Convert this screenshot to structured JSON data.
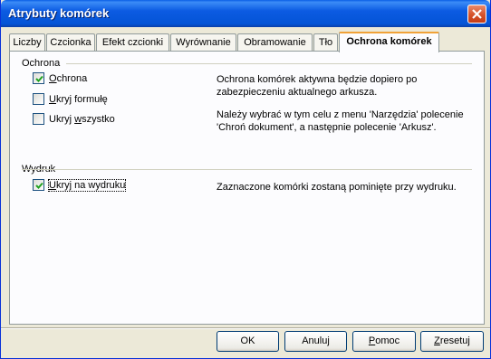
{
  "window": {
    "title": "Atrybuty komórek",
    "close_icon": "close-icon"
  },
  "tabs": [
    {
      "label": "Liczby"
    },
    {
      "label": "Czcionka"
    },
    {
      "label": "Efekt czcionki"
    },
    {
      "label": "Wyrównanie"
    },
    {
      "label": "Obramowanie"
    },
    {
      "label": "Tło"
    },
    {
      "label": "Ochrona komórek",
      "active": true
    }
  ],
  "protection": {
    "group_label": "Ochrona",
    "options": [
      {
        "pre": "",
        "key": "O",
        "post": "chrona",
        "checked": true
      },
      {
        "pre": "",
        "key": "U",
        "post": "kryj formułę",
        "checked": false
      },
      {
        "pre": "Ukryj ",
        "key": "w",
        "post": "szystko",
        "checked": false
      }
    ],
    "desc1_line1": "Ochrona komórek aktywna będzie dopiero po",
    "desc1_line2": "zabezpieczeniu aktualnego arkusza.",
    "desc2_line1": "Należy wybrać w tym celu z menu 'Narzędzia' polecenie",
    "desc2_line2": "'Chroń dokument', a następnie polecenie 'Arkusz'."
  },
  "print": {
    "group_label": "Wydruk",
    "option": {
      "pre": "",
      "key": "U",
      "post": "kryj na wydruku",
      "checked": true
    },
    "desc": "Zaznaczone komórki zostaną pominięte przy wydruku."
  },
  "buttons": {
    "ok": "OK",
    "cancel": "Anuluj",
    "help_key": "P",
    "help_rest": "omoc",
    "reset_key": "Z",
    "reset_rest": "resetuj"
  },
  "colors": {
    "titlebar": "#0454d6",
    "active_tab_accent": "#f0a238",
    "face": "#ece9d8",
    "panel": "#fcfcfe"
  }
}
